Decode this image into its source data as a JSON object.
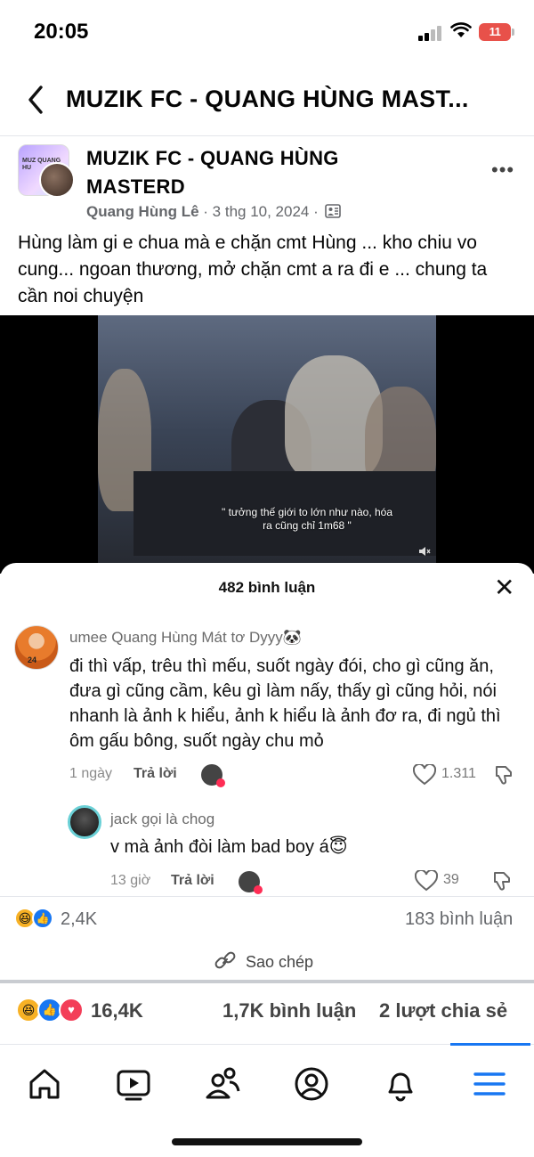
{
  "status": {
    "time": "20:05",
    "battery": "11"
  },
  "header": {
    "title": "MUZIK FC - QUANG HÙNG MAST..."
  },
  "post": {
    "group_name": "MUZIK FC - QUANG HÙNG MASTERD",
    "group_avatar_text": "MUZ QUANG HU",
    "author": "Quang Hùng Lê",
    "date": "· 3 thg 10, 2024 ·",
    "text": "Hùng làm gi e chua mà e chặn cmt Hùng ... kho chiu vo cung... ngoan thương, mở chặn cmt a ra đi e ... chung ta cần noi chuyện"
  },
  "video": {
    "caption": "\" tưởng thế giới to lớn như nào, hóa ra cũng chỉ 1m68 \""
  },
  "comments_sheet": {
    "title": "482 bình luận",
    "comments": [
      {
        "name": "umee Quang Hùng Mát tơ Dyyy🐼",
        "avatar_text": "24",
        "text": "đi thì vấp, trêu thì mếu, suốt ngày đói, cho gì cũng ăn, đưa gì cũng cầm, kêu gì làm nấy, thấy gì cũng hỏi, nói nhanh là ảnh k hiểu, ảnh k hiểu là ảnh đơ ra, đi ngủ thì ôm gấu bông, suốt ngày chu mỏ",
        "time": "1 ngày",
        "reply": "Trả lời",
        "likes": "1.311"
      },
      {
        "name": "jack gọi là chog",
        "text": "v mà ảnh đòi làm bad boy á😇",
        "time": "13 giờ",
        "reply": "Trả lời",
        "likes": "39"
      }
    ]
  },
  "inner_post_stats": {
    "reactions": "2,4K",
    "comments": "183 bình luận"
  },
  "copy_label": "Sao chép",
  "outer_post_stats": {
    "reactions": "16,4K",
    "comments": "1,7K bình luận",
    "shares": "2 lượt chia sẻ"
  },
  "colors": {
    "accent": "#1877f2",
    "like": "#1877f2",
    "love": "#f33e58",
    "haha": "#f7b125"
  },
  "tabbar": {
    "items": [
      "home-icon",
      "video-icon",
      "friends-icon",
      "profile-icon",
      "bell-icon",
      "menu-icon"
    ],
    "active": "menu-icon"
  }
}
